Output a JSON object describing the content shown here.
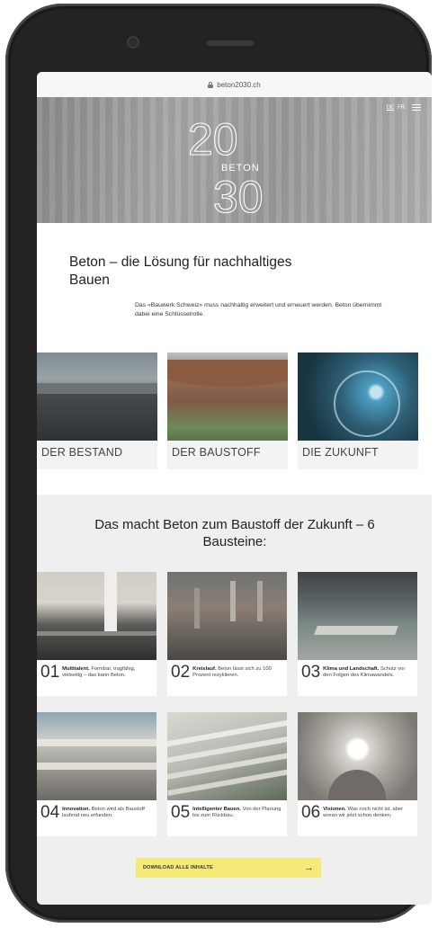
{
  "browser": {
    "url": "beton2030.ch"
  },
  "header": {
    "languages": [
      "DE",
      "FR"
    ],
    "active_language": "DE",
    "logo": {
      "top": "20",
      "middle": "BETON",
      "bottom": "30"
    }
  },
  "intro": {
    "title": "Beton – die Lösung für nachhaltiges Bauen",
    "text": "Das «Bauwerk Schweiz» muss nachhaltig erweitert und erneuert werden. Beton übernimmt dabei eine Schlüsselrolle."
  },
  "categories": [
    {
      "label": "DER BESTAND"
    },
    {
      "label": "DER BAUSTOFF"
    },
    {
      "label": "DIE ZUKUNFT"
    }
  ],
  "building_blocks": {
    "title": "Das macht Beton zum Baustoff der Zukunft – 6 Bausteine:",
    "items": [
      {
        "number": "01",
        "heading": "Multitalent.",
        "text": "Formbar, tragfähig, vielseitig – das kann Beton."
      },
      {
        "number": "02",
        "heading": "Kreislauf.",
        "text": "Beton lässt sich zu 100 Prozent rezyklieren."
      },
      {
        "number": "03",
        "heading": "Klima und Landschaft.",
        "text": "Schutz vor den Folgen des Klimawandels."
      },
      {
        "number": "04",
        "heading": "Innovation.",
        "text": "Beton wird als Baustoff laufend neu erfunden."
      },
      {
        "number": "05",
        "heading": "Intelligenter Bauen.",
        "text": "Von der Planung bis zum Rückbau."
      },
      {
        "number": "06",
        "heading": "Visionen.",
        "text": "Was noch nicht ist, aber woran wir jetzt schon denken."
      }
    ]
  },
  "download": {
    "label": "DOWNLOAD ALLE INHALTE"
  },
  "colors": {
    "accent": "#f5ea78",
    "section_bg": "#efefef"
  }
}
